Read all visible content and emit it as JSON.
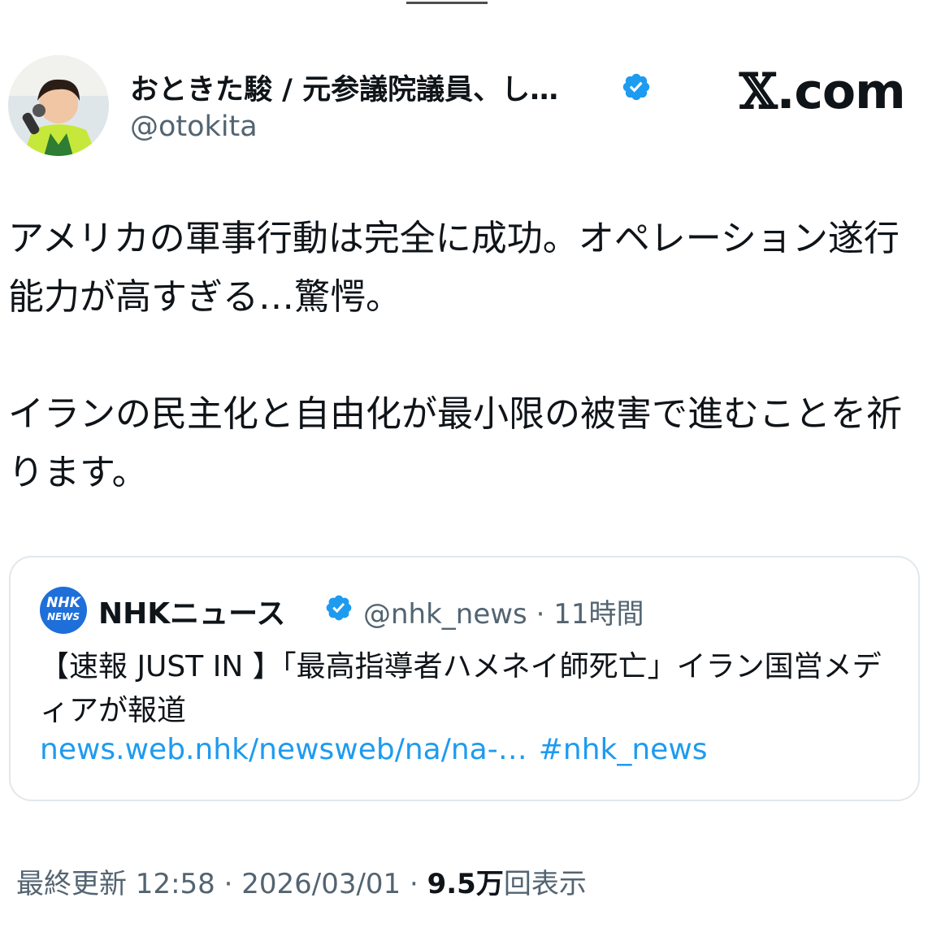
{
  "author": {
    "name": "おときた駿 / 元参議院議員、し…",
    "handle": "@otokita",
    "avatar_icon": "person-portrait-with-microphone"
  },
  "site_logo": {
    "glyph": "𝕏",
    "text": ".com"
  },
  "tweet": {
    "paragraph1": "アメリカの軍事行動は完全に成功。オペレーション遂行能力が高すぎる…驚愕。",
    "paragraph2": "イランの民主化と自由化が最小限の被害で進むことを祈ります。"
  },
  "quote": {
    "logo_line1": "NHK",
    "logo_line2": "NEWS",
    "name": "NHKニュース",
    "handle_time": "@nhk_news · 11時間",
    "text": "【速報 JUST IN 】「最高指導者ハメネイ師死亡」イラン国営メディアが報道",
    "link": "news.web.nhk/newsweb/na/na-…",
    "hashtag": "#nhk_news"
  },
  "meta": {
    "updated": "最終更新 12:58 · 2026/03/01 ·",
    "views_count": "9.5万",
    "views_label": "回表示"
  },
  "colors": {
    "verified": "#1d9bf0",
    "link": "#1d9bf0",
    "secondary": "#536471",
    "nhk_blue": "#1e6fd9"
  }
}
